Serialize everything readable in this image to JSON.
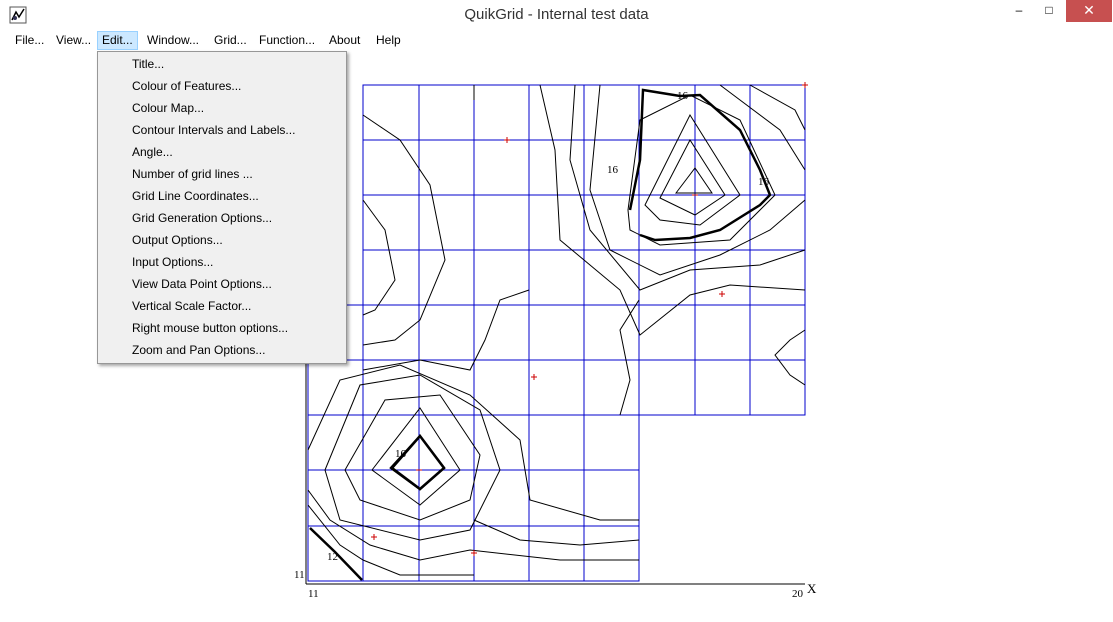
{
  "window": {
    "title": "QuikGrid - Internal test data",
    "min_glyph": "–",
    "max_glyph": "□",
    "close_glyph": "✕"
  },
  "menu": {
    "items": [
      "File...",
      "View...",
      "Edit...",
      "Window...",
      "Grid...",
      "Function...",
      "About",
      "Help"
    ],
    "active": "Edit..."
  },
  "edit_menu": {
    "items": [
      "Title...",
      "Colour of Features...",
      "Colour Map...",
      "Contour Intervals and Labels...",
      "Angle...",
      "Number of grid lines ...",
      "Grid Line Coordinates...",
      "Grid Generation Options...",
      "Output Options...",
      "Input Options...",
      "View Data Point Options...",
      "Vertical Scale Factor...",
      "Right mouse button options...",
      "Zoom and Pan Options..."
    ]
  },
  "plot": {
    "x_axis_label": "X",
    "x_min_label": "11",
    "x_max_label": "20",
    "y_min_label": "11",
    "contour_labels": [
      "16",
      "16",
      "16",
      "16",
      "12"
    ],
    "grid_color": "#0000cc",
    "contour_color": "#000000",
    "data_point_color": "#cc0000"
  }
}
